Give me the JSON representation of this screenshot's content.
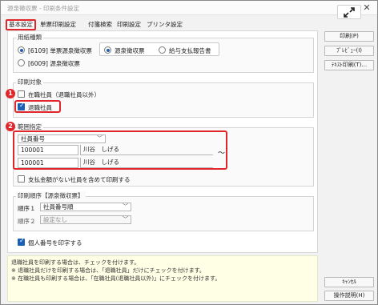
{
  "window": {
    "title": "源泉徴収票 - 印刷条件設定",
    "close_glyph": "✕"
  },
  "tabs": [
    {
      "label": "基本設定",
      "active": true
    },
    {
      "label": "単票印刷設定",
      "active": false
    },
    {
      "label": "付箋検索",
      "active": false
    },
    {
      "label": "印刷設定",
      "active": false
    },
    {
      "label": "プリンタ設定",
      "active": false
    }
  ],
  "paper_type": {
    "label": "用紙種類",
    "options": [
      {
        "label": "[6109] 単票源泉徴収票",
        "selected": true
      },
      {
        "label": "[6009] 源泉徴収票",
        "selected": false
      }
    ],
    "sub_options": [
      {
        "label": "源泉徴収票",
        "selected": true
      },
      {
        "label": "給与支払報告書",
        "selected": false
      }
    ]
  },
  "print_target": {
    "label": "印刷対象",
    "options": [
      {
        "label": "在職社員（退職社員以外）",
        "checked": false
      },
      {
        "label": "退職社員",
        "checked": true
      }
    ],
    "badge": "1"
  },
  "range": {
    "label": "範囲指定",
    "badge": "2",
    "field_select": "社員番号",
    "from_code": "100001",
    "from_name": "川谷　しげる",
    "to_code": "100001",
    "to_name": "川谷　しげる",
    "tilde": "～",
    "include_zero_label": "支払金額がない社員を含めて印刷する",
    "include_zero_checked": false
  },
  "print_order": {
    "label": "印刷順序【源泉徴収票】",
    "order1_label": "順序１",
    "order1_value": "社員番号順",
    "order2_label": "順序２",
    "order2_value": "設定なし"
  },
  "personal_number": {
    "label": "個人番号を印字する",
    "checked": true
  },
  "buttons": {
    "print": "印刷(P)",
    "preview": "ﾌﾟﾚﾋﾞｭｰ(I)",
    "text_print": "ﾃｷｽﾄ印刷(T)...",
    "cancel": "ｷｬﾝｾﾙ",
    "help": "操作説明(H)"
  },
  "help_text": [
    "退職社員を印刷する場合は、チェックを付けます。",
    "※ 退職社員だけを印刷する場合は、「退職社員」だけにチェックを付けます。",
    "※ 在職社員も印刷する場合は、「在職社員(退職社員以外)」にチェックを付けます。"
  ],
  "colors": {
    "highlight": "#e0262b",
    "accent": "#1a5fb4",
    "help_bg": "#ffffe6"
  }
}
